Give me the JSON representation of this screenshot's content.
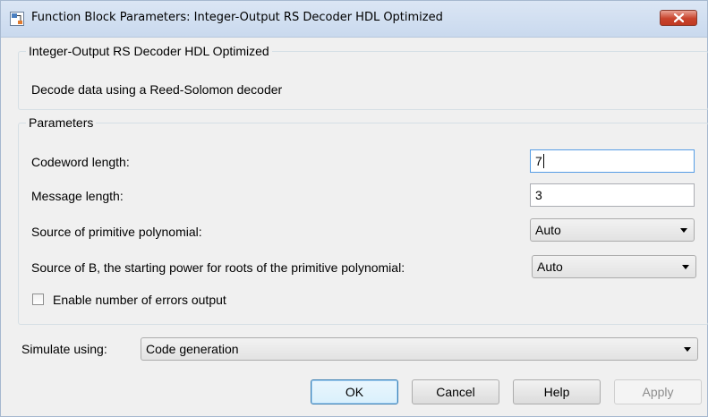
{
  "window": {
    "title": "Function Block Parameters: Integer-Output RS Decoder HDL Optimized",
    "icon": "simulink-block-icon",
    "close_icon": "close-icon"
  },
  "description": {
    "group_title": "Integer-Output RS Decoder HDL Optimized",
    "text": "Decode data using a Reed-Solomon decoder"
  },
  "parameters": {
    "group_title": "Parameters",
    "codeword_length": {
      "label": "Codeword length:",
      "value": "7"
    },
    "message_length": {
      "label": "Message length:",
      "value": "3"
    },
    "primitive_polynomial_source": {
      "label": "Source of primitive polynomial:",
      "value": "Auto"
    },
    "b_source": {
      "label": "Source of B, the starting power for roots of the primitive polynomial:",
      "value": "Auto"
    },
    "errors_output": {
      "label": "Enable number of errors output",
      "checked": false
    }
  },
  "simulate": {
    "label": "Simulate using:",
    "value": "Code generation"
  },
  "buttons": {
    "ok": "OK",
    "cancel": "Cancel",
    "help": "Help",
    "apply": "Apply"
  }
}
